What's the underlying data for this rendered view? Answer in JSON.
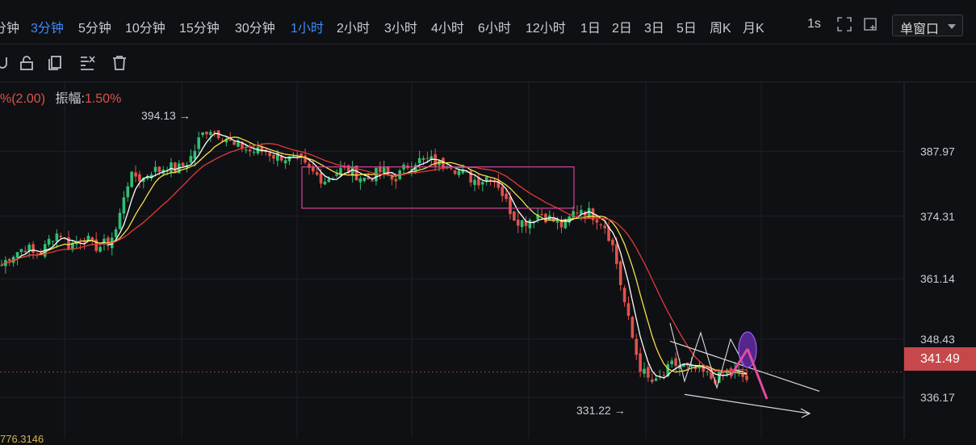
{
  "toolbar": {
    "timeframes": [
      "分钟",
      "3分钟",
      "5分钟",
      "10分钟",
      "15分钟",
      "30分钟",
      "1小时",
      "2小时",
      "3小时",
      "4小时",
      "6小时",
      "12小时",
      "1日",
      "2日",
      "3日",
      "5日",
      "周K",
      "月K"
    ],
    "active_timeframes": [
      "3分钟",
      "1小时"
    ],
    "interval_label": "1s",
    "window_mode": "单窗口"
  },
  "drawing_tools": [
    "magnet-icon",
    "lock-icon",
    "layers-icon",
    "visibility-icon",
    "trash-icon"
  ],
  "info_bar": {
    "change": "%(2.00)",
    "amplitude_label": "振幅:",
    "amplitude_value": "1.50%"
  },
  "bottom_text": "776.3146",
  "colors": {
    "up": "#2fbf71",
    "down": "#e0524c",
    "ma_fast": "#ffffff",
    "ma_mid": "#f5e04a",
    "ma_slow": "#e23a3a",
    "accent": "#3d8bfd"
  },
  "chart_data": {
    "type": "candlestick",
    "y_axis": {
      "ticks": [
        387.97,
        374.31,
        361.14,
        348.43,
        336.17
      ],
      "ylim": [
        327.5,
        402.5
      ],
      "position": "right"
    },
    "last_price": 341.49,
    "annotations": {
      "high": "394.13",
      "low": "331.22"
    },
    "series": [
      {
        "name": "close_path",
        "values": [
          364,
          366,
          367,
          368,
          366,
          367,
          370,
          371,
          368,
          369,
          370,
          368,
          368,
          369,
          372,
          381,
          383,
          382,
          384,
          384,
          385,
          384,
          385,
          387,
          391,
          393,
          392,
          391,
          389,
          389,
          388,
          388,
          388,
          387,
          387,
          386,
          386,
          384,
          383,
          382,
          383,
          384,
          384,
          383,
          382,
          383,
          384,
          382,
          383,
          385,
          386,
          386,
          386,
          385,
          386,
          384,
          383,
          382,
          382,
          383,
          381,
          377,
          374,
          373,
          374,
          375,
          374,
          373,
          372,
          375,
          376,
          375,
          374,
          372,
          367,
          358,
          350,
          343,
          340,
          339,
          341,
          343,
          343,
          342,
          342,
          341,
          340,
          341,
          342,
          341,
          340
        ]
      }
    ],
    "range_box": {
      "y_top": 384.7,
      "y_bottom": 376.0
    },
    "triangle_pattern": {
      "upper_start": 348.0,
      "lower_start": 339.0
    }
  }
}
